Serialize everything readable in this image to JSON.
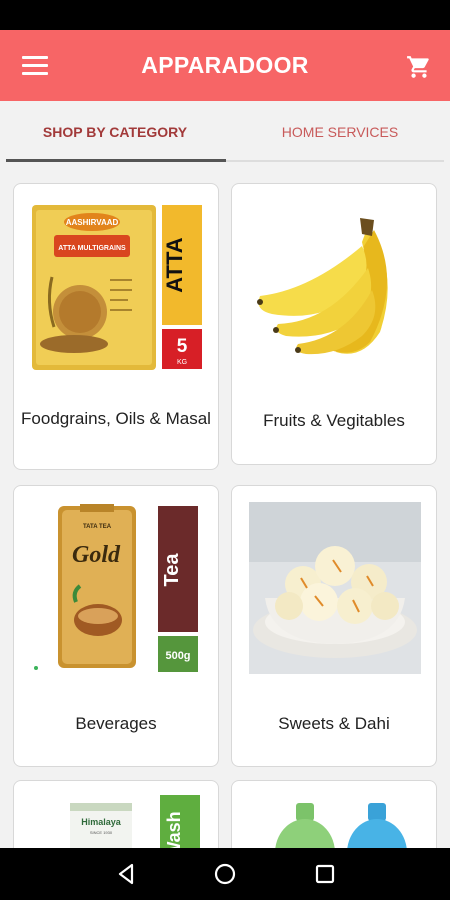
{
  "app": {
    "title": "APPARADOOR"
  },
  "tabs": [
    {
      "label": "SHOP BY CATEGORY"
    },
    {
      "label": "HOME SERVICES"
    }
  ],
  "categories": [
    {
      "label": "Foodgrains, Oils & Masal",
      "pack_brand": "AASHIRVAAD",
      "pack_name": "ATTA MULTIGRAINS",
      "side_text": "ATTA",
      "weight_num": "5",
      "weight_unit": "KG"
    },
    {
      "label": "Fruits & Vegitables"
    },
    {
      "label": "Beverages",
      "pack_brand": "TATA TEA",
      "pack_name": "Gold",
      "side_text": "Tea",
      "weight": "500g"
    },
    {
      "label": "Sweets & Dahi"
    },
    {
      "label": "",
      "pack_brand": "Himalaya",
      "pack_sub": "SINCE 1930",
      "side_text": "Wash"
    },
    {
      "label": ""
    }
  ],
  "colors": {
    "appbar": "#f76566",
    "active_tab": "#a23a3a",
    "inactive_tab": "#c85a5a"
  },
  "icons": {
    "menu": "menu-icon",
    "cart": "cart-icon",
    "back": "back-icon",
    "home": "home-icon",
    "recents": "recents-icon"
  }
}
